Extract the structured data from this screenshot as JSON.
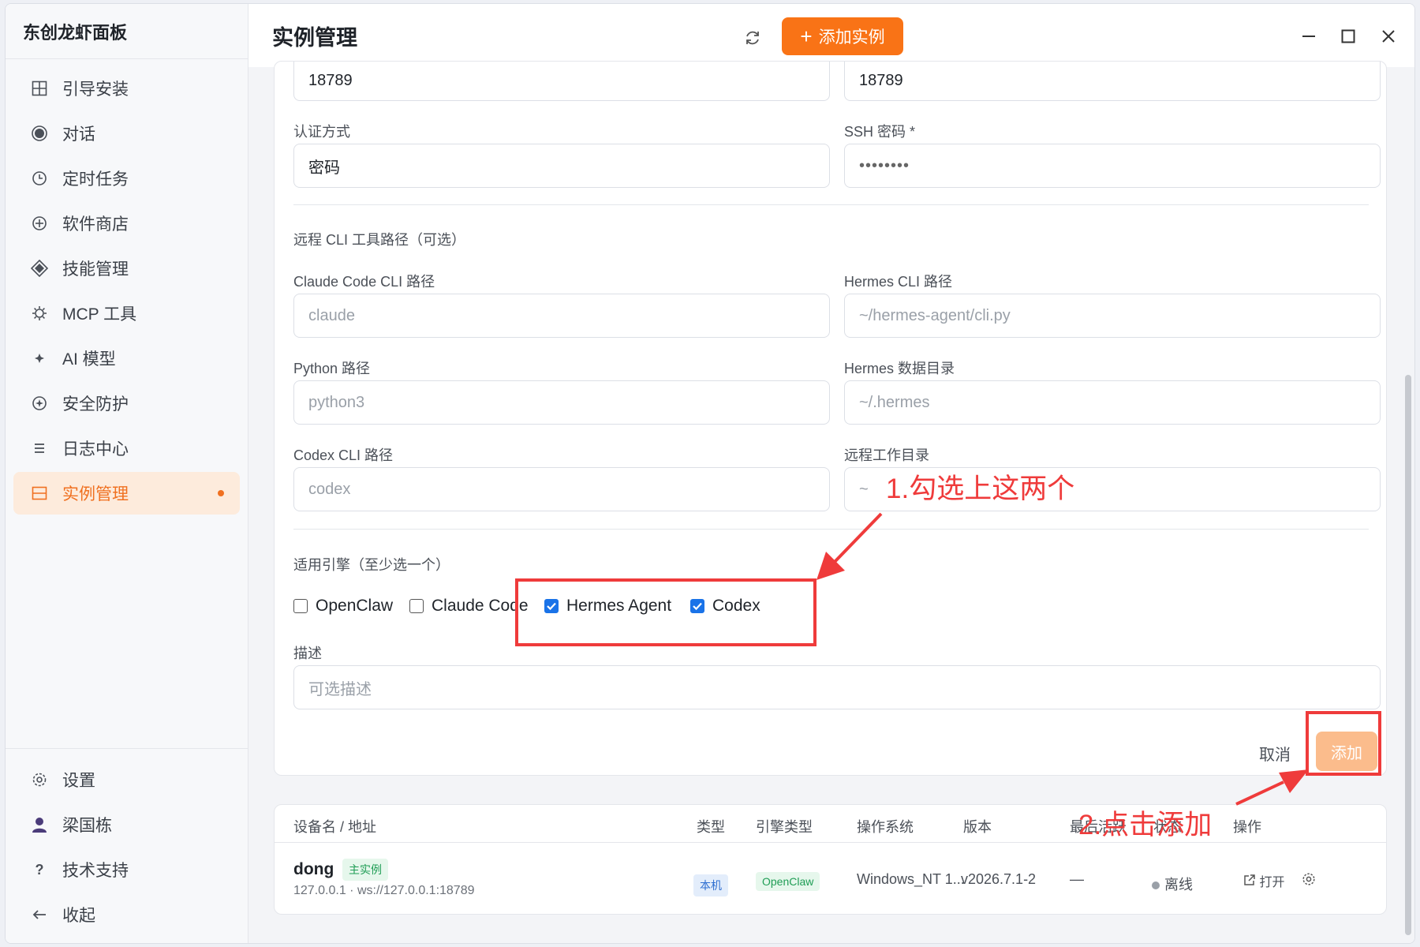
{
  "app_name": "东创龙虾面板",
  "sidebar": {
    "items": [
      {
        "label": "引导安装",
        "icon": "grid-icon"
      },
      {
        "label": "对话",
        "icon": "chat-circle-icon"
      },
      {
        "label": "定时任务",
        "icon": "clock-icon"
      },
      {
        "label": "软件商店",
        "icon": "store-icon"
      },
      {
        "label": "技能管理",
        "icon": "diamond-icon"
      },
      {
        "label": "MCP 工具",
        "icon": "gear-sun-icon"
      },
      {
        "label": "AI 模型",
        "icon": "sparkle-icon"
      },
      {
        "label": "安全防护",
        "icon": "shield-circle-icon"
      },
      {
        "label": "日志中心",
        "icon": "list-icon"
      },
      {
        "label": "实例管理",
        "icon": "instance-icon",
        "active": true
      }
    ],
    "bottom": [
      {
        "label": "设置",
        "icon": "settings-icon"
      },
      {
        "label": "梁国栋",
        "icon": "user-icon"
      },
      {
        "label": "技术支持",
        "icon": "help-icon"
      },
      {
        "label": "收起",
        "icon": "collapse-arrow-icon"
      }
    ]
  },
  "header": {
    "title": "实例管理",
    "add_label": "添加实例"
  },
  "form": {
    "port_left": "18789",
    "port_right": "18789",
    "auth_label": "认证方式",
    "auth_value": "密码",
    "ssh_label": "SSH 密码 *",
    "ssh_value": "••••••••",
    "cli_section": "远程 CLI 工具路径（可选）",
    "claude_label": "Claude Code CLI 路径",
    "claude_ph": "claude",
    "hermes_cli_label": "Hermes CLI 路径",
    "hermes_cli_ph": "~/hermes-agent/cli.py",
    "python_label": "Python 路径",
    "python_ph": "python3",
    "hermes_data_label": "Hermes 数据目录",
    "hermes_data_ph": "~/.hermes",
    "codex_label": "Codex CLI 路径",
    "codex_ph": "codex",
    "workdir_label": "远程工作目录",
    "workdir_ph": "~",
    "engine_section": "适用引擎（至少选一个）",
    "engines": [
      {
        "label": "OpenClaw",
        "checked": false
      },
      {
        "label": "Claude Code",
        "checked": false
      },
      {
        "label": "Hermes Agent",
        "checked": true
      },
      {
        "label": "Codex",
        "checked": true
      }
    ],
    "desc_label": "描述",
    "desc_ph": "可选描述",
    "cancel_label": "取消",
    "submit_label": "添加"
  },
  "annotations": {
    "step1": "1.勾选上这两个",
    "step2": "2.点击添加",
    "color": "#ef3b3b"
  },
  "table": {
    "headers": [
      "设备名 / 地址",
      "类型",
      "引擎类型",
      "操作系统",
      "版本",
      "最后活跃",
      "状态",
      "操作"
    ],
    "rows": [
      {
        "name": "dong",
        "tag": "主实例",
        "address": "127.0.0.1 · ws://127.0.0.1:18789",
        "type": "本机",
        "engine": "OpenClaw",
        "os": "Windows_NT 1...",
        "version": "v2026.7.1-2",
        "last_active": "—",
        "status": "离线",
        "open_label": "打开"
      }
    ]
  },
  "colors": {
    "accent": "#f97316",
    "active_bg": "#fdebdc",
    "check_blue": "#1a73e8"
  }
}
